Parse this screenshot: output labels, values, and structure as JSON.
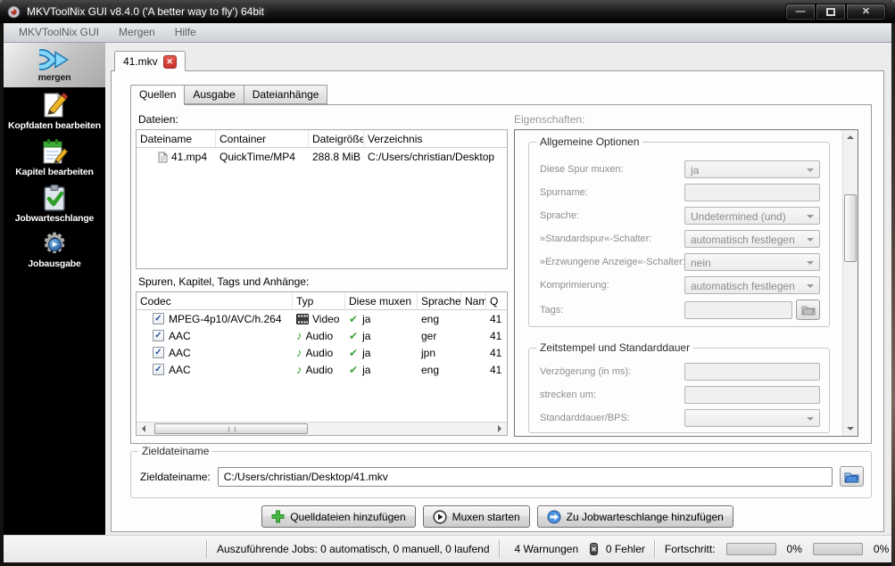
{
  "window": {
    "title": "MKVToolNix GUI v8.4.0 ('A better way to fly') 64bit"
  },
  "menubar": {
    "items": [
      "MKVToolNix GUI",
      "Mergen",
      "Hilfe"
    ]
  },
  "sidebar": {
    "items": [
      {
        "label": "mergen",
        "selected": true
      },
      {
        "label": "Kopfdaten bearbeiten",
        "selected": false
      },
      {
        "label": "Kapitel bearbeiten",
        "selected": false
      },
      {
        "label": "Jobwarteschlange",
        "selected": false
      },
      {
        "label": "Jobausgabe",
        "selected": false
      }
    ]
  },
  "merge_tab": {
    "title": "41.mkv"
  },
  "subtabs": {
    "items": [
      "Quellen",
      "Ausgabe",
      "Dateianhänge"
    ],
    "active": "Quellen"
  },
  "files": {
    "label": "Dateien:",
    "columns": [
      "Dateiname",
      "Container",
      "Dateigröße",
      "Verzeichnis"
    ],
    "rows": [
      {
        "name": "41.mp4",
        "container": "QuickTime/MP4",
        "size": "288.8 MiB",
        "directory": "C:/Users/christian/Desktop"
      }
    ]
  },
  "tracks": {
    "label": "Spuren, Kapitel, Tags und Anhänge:",
    "columns": [
      "Codec",
      "Typ",
      "Diese muxen",
      "Sprache",
      "Name",
      "Q"
    ],
    "rows": [
      {
        "checked": true,
        "codec": "MPEG-4p10/AVC/h.264",
        "type": "Video",
        "mux": "ja",
        "language": "eng",
        "name": "",
        "source": "41"
      },
      {
        "checked": true,
        "codec": "AAC",
        "type": "Audio",
        "mux": "ja",
        "language": "ger",
        "name": "",
        "source": "41"
      },
      {
        "checked": true,
        "codec": "AAC",
        "type": "Audio",
        "mux": "ja",
        "language": "jpn",
        "name": "",
        "source": "41"
      },
      {
        "checked": true,
        "codec": "AAC",
        "type": "Audio",
        "mux": "ja",
        "language": "eng",
        "name": "",
        "source": "41"
      }
    ]
  },
  "properties": {
    "label": "Eigenschaften:",
    "general": {
      "title": "Allgemeine Optionen",
      "fields": [
        {
          "label": "Diese Spur muxen:",
          "value": "ja"
        },
        {
          "label": "Spurname:",
          "value": ""
        },
        {
          "label": "Sprache:",
          "value": "Undetermined (und)"
        },
        {
          "label": "»Standardspur«-Schalter:",
          "value": "automatisch festlegen"
        },
        {
          "label": "»Erzwungene Anzeige«-Schalter:",
          "value": "nein"
        },
        {
          "label": "Komprimierung:",
          "value": "automatisch festlegen"
        },
        {
          "label": "Tags:",
          "value": ""
        }
      ]
    },
    "timestamps": {
      "title": "Zeitstempel und Standarddauer",
      "fields": [
        {
          "label": "Verzögerung (in ms):",
          "value": ""
        },
        {
          "label": "strecken um:",
          "value": ""
        },
        {
          "label": "Standarddauer/BPS:",
          "value": ""
        }
      ]
    }
  },
  "destination": {
    "group_title": "Zieldateiname",
    "label": "Zieldateiname:",
    "value": "C:/Users/christian/Desktop/41.mkv"
  },
  "actions": {
    "add_sources": "Quelldateien hinzufügen",
    "start_muxing": "Muxen starten",
    "add_to_queue": "Zu Jobwarteschlange hinzufügen"
  },
  "statusbar": {
    "jobs_text": "Auszuführende Jobs:  0 automatisch, 0 manuell, 0 laufend",
    "warnings": "4 Warnungen",
    "errors": "0 Fehler",
    "progress_label": "Fortschritt:",
    "progress_current": "0%",
    "progress_total": "0%"
  },
  "icons": {
    "checkmark": "✔",
    "checkbox_check": "✓",
    "music_note": "♪",
    "gear": "⚙",
    "play_small": "▶",
    "close_glyph": "✕",
    "minimize_glyph": "—"
  },
  "colors": {
    "check_green": "#3fa33b",
    "warning_yellow": "#fbc51d",
    "tab_close_red": "#d9534f",
    "sidebar_bg": "#000000"
  }
}
